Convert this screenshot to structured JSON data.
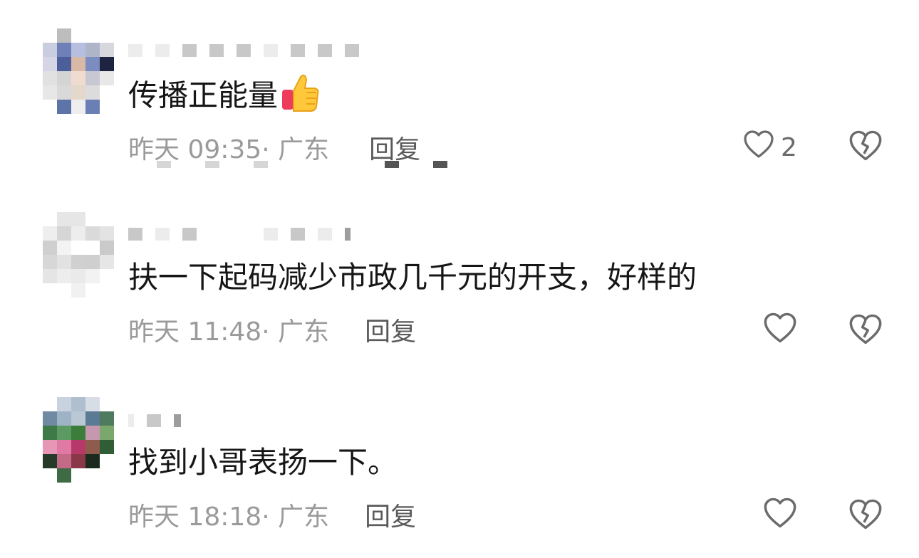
{
  "comments": [
    {
      "text": "传播正能量",
      "emoji": "thumbs-up",
      "time": "昨天 09:35· 广东",
      "reply": "回复",
      "likes": "2"
    },
    {
      "text": "扶一下起码减少市政几千元的开支，好样的",
      "time": "昨天 11:48· 广东",
      "reply": "回复",
      "likes": ""
    },
    {
      "text": "找到小哥表扬一下。",
      "time": "昨天 18:18· 广东",
      "reply": "回复",
      "likes": ""
    }
  ],
  "icons": {
    "like": "heart-outline-icon",
    "dislike": "broken-heart-icon"
  },
  "colors": {
    "text": "#161616",
    "meta": "#9a9a9a",
    "reply": "#5a5a5a",
    "icon": "#6b6b6b"
  }
}
